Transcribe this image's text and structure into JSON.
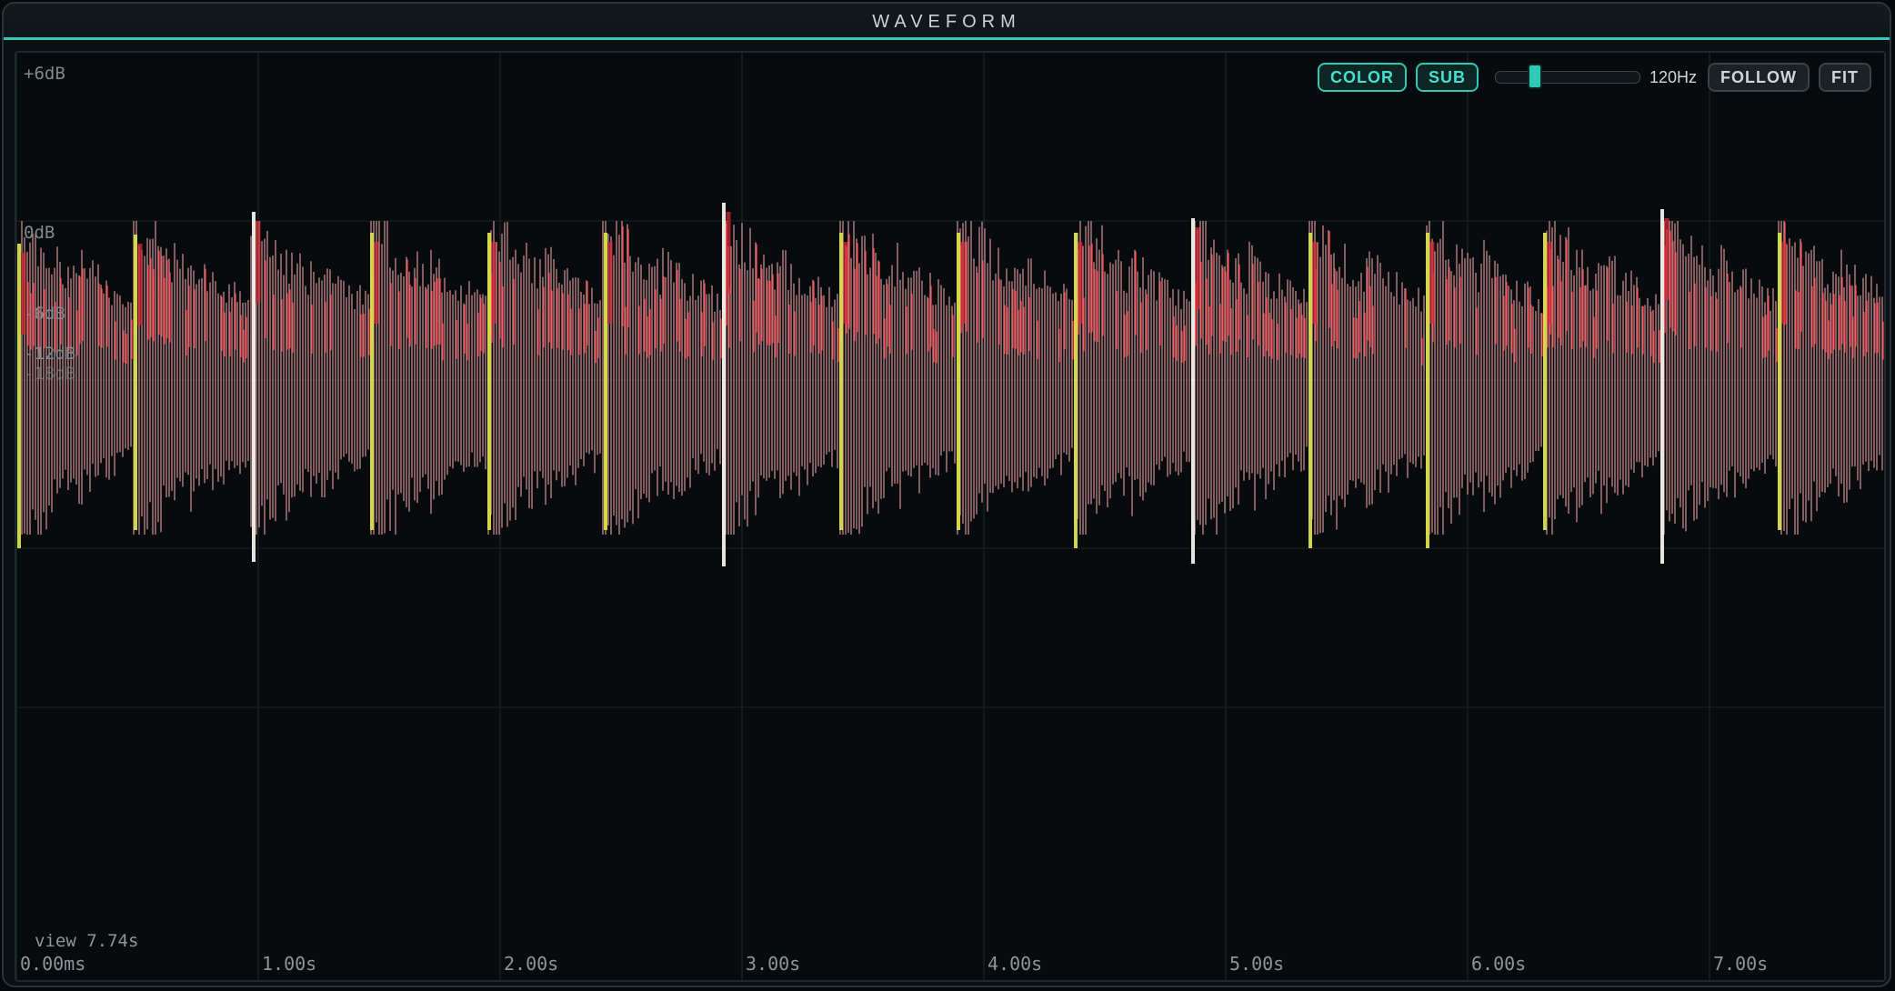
{
  "window": {
    "title": "WAVEFORM"
  },
  "toolbar": {
    "color_label": "COLOR",
    "sub_label": "SUB",
    "crossover_value": 0.25,
    "crossover_label": "120Hz",
    "follow_label": "FOLLOW",
    "fit_label": "FIT"
  },
  "db_labels": [
    "+6dB",
    "0dB",
    "-6dB",
    "-12dB",
    "-18dB"
  ],
  "time_labels": [
    "0.00ms",
    "1.00s",
    "2.00s",
    "3.00s",
    "4.00s",
    "5.00s",
    "6.00s",
    "7.00s"
  ],
  "view_label": "view 7.74s",
  "colors": {
    "accent": "#2fc9b8",
    "wave_body": "#e8a3a8",
    "wave_red": "#e02a36",
    "transient_yellow": "#d8e04a",
    "transient_white": "#f2f2ea"
  },
  "view_seconds": 7.74
}
